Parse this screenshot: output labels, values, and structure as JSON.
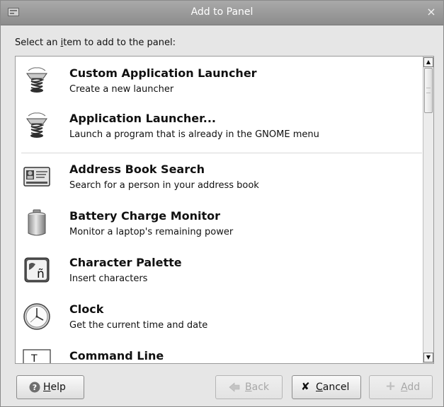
{
  "window": {
    "title": "Add to Panel",
    "close_symbol": "×"
  },
  "instruction": {
    "before": "Select an ",
    "mnemonic": "i",
    "after": "tem to add to the panel:"
  },
  "items": [
    {
      "name": "Custom Application Launcher",
      "description": "Create a new launcher",
      "icon": "launcher-spring-icon"
    },
    {
      "name": "Application Launcher...",
      "description": "Launch a program that is already in the GNOME menu",
      "icon": "launcher-spring-icon"
    },
    {
      "name": "Address Book Search",
      "description": "Search for a person in your address book",
      "icon": "address-card-icon"
    },
    {
      "name": "Battery Charge Monitor",
      "description": "Monitor a laptop's remaining power",
      "icon": "battery-icon"
    },
    {
      "name": "Character Palette",
      "description": "Insert characters",
      "icon": "character-palette-icon"
    },
    {
      "name": "Clock",
      "description": "Get the current time and date",
      "icon": "clock-icon"
    },
    {
      "name": "Command Line",
      "description": "",
      "icon": "command-line-icon"
    }
  ],
  "icon_glyphs": {
    "character": "ñ",
    "command": "T",
    "help": "?",
    "cancel": "✘",
    "add": "+",
    "scroll_up": "▲",
    "scroll_down": "▼"
  },
  "buttons": {
    "help": {
      "mnemonic": "H",
      "rest": "elp"
    },
    "back": {
      "mnemonic": "B",
      "rest": "ack"
    },
    "cancel": {
      "mnemonic": "C",
      "rest": "ancel"
    },
    "add": {
      "mnemonic": "A",
      "rest": "dd"
    }
  }
}
